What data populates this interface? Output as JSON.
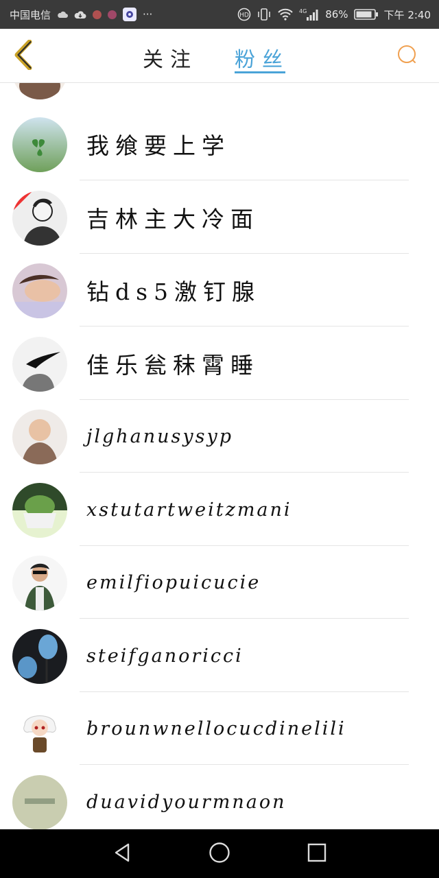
{
  "status_bar": {
    "carrier": "中国电信",
    "extra": "···",
    "network": "4G",
    "battery": "86%",
    "time": "下午 2:40"
  },
  "header": {
    "tabs": [
      {
        "label": "关注",
        "active": false
      },
      {
        "label": "粉丝",
        "active": true
      }
    ],
    "accent_color": "#4aa3d8",
    "back_icon": "chevron-left-icon",
    "search_icon": "search-icon"
  },
  "followers": [
    {
      "name": "我飨要上学"
    },
    {
      "name": "吉林主大冷面"
    },
    {
      "name": "钻ds5激钉腺"
    },
    {
      "name": "佳乐瓮秣霄睡"
    },
    {
      "name": "jlghanusysyp"
    },
    {
      "name": "xstutartweitzmani"
    },
    {
      "name": "emilfiopuicucie"
    },
    {
      "name": "steifganoricci"
    },
    {
      "name": "brounwnellocucdinelili"
    },
    {
      "name": "duavidyourmnaon"
    }
  ],
  "nav_bar": {
    "back": "triangle-back-icon",
    "home": "circle-home-icon",
    "recents": "square-recents-icon"
  }
}
